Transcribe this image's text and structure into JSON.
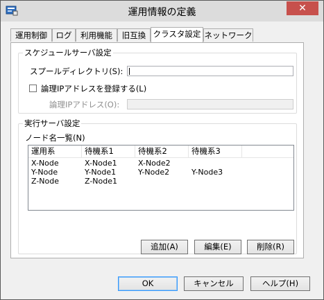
{
  "window": {
    "title": "運用情報の定義",
    "close_glyph": "✕"
  },
  "tabs": [
    {
      "label": "運用制御"
    },
    {
      "label": "ログ"
    },
    {
      "label": "利用機能"
    },
    {
      "label": "旧互換"
    },
    {
      "label": "クラスタ設定",
      "active": true
    },
    {
      "label": "ネットワーク"
    }
  ],
  "schedule_group": {
    "title": "スケジュールサーバ設定",
    "spool_label": "スプールディレクトリ(S):",
    "spool_value": "",
    "register_checkbox_label": "論理IPアドレスを登録する(L)",
    "register_checked": false,
    "logical_ip_label": "論理IPアドレス(O):",
    "logical_ip_value": ""
  },
  "exec_group": {
    "title": "実行サーバ設定",
    "node_list_label": "ノード名一覧(N)",
    "columns": [
      "運用系",
      "待機系1",
      "待機系2",
      "待機系3"
    ],
    "rows": [
      [
        "X-Node",
        "X-Node1",
        "X-Node2",
        ""
      ],
      [
        "Y-Node",
        "Y-Node1",
        "Y-Node2",
        "Y-Node3"
      ],
      [
        "Z-Node",
        "Z-Node1",
        "",
        ""
      ]
    ],
    "add_button": "追加(A)",
    "edit_button": "編集(E)",
    "delete_button": "削除(R)"
  },
  "footer": {
    "ok_button": "OK",
    "cancel_button": "キャンセル",
    "help_button": "ヘルプ(H)"
  },
  "colors": {
    "close_button": "#c7504c",
    "default_button_border": "#3399ff"
  }
}
